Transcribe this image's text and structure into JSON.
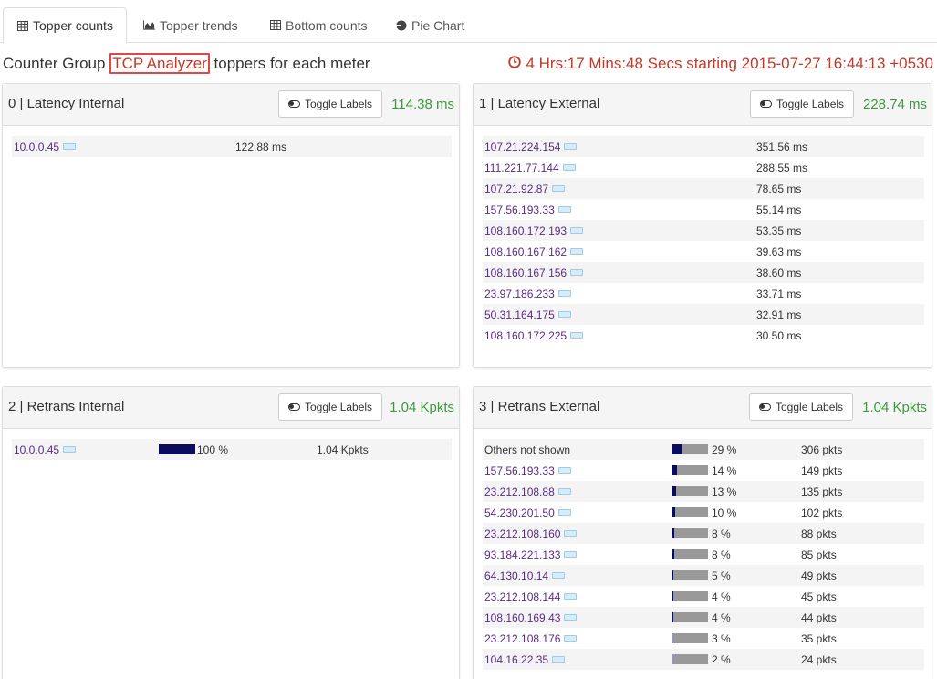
{
  "tabs": [
    {
      "label": "Topper counts",
      "icon": "table-icon",
      "active": true
    },
    {
      "label": "Topper trends",
      "icon": "area-chart-icon",
      "active": false
    },
    {
      "label": "Bottom counts",
      "icon": "table-icon",
      "active": false
    },
    {
      "label": "Pie Chart",
      "icon": "pie-chart-icon",
      "active": false
    }
  ],
  "heading": {
    "prefix": "Counter Group ",
    "group": "TCP Analyzer",
    "suffix": " toppers for each meter"
  },
  "timeinfo": "4 Hrs:17 Mins:48 Secs starting 2015-07-27 16:44:13 +0530",
  "toggle_label": "Toggle Labels",
  "colors": {
    "accent_red": "#c0392b",
    "total_green": "#3c9a3c",
    "link_purple": "#5b2a86",
    "bar_fill": "#0c0c5c",
    "bar_bg": "#999999"
  },
  "panels": [
    {
      "title": "0 | Latency Internal",
      "total": "114.38 ms",
      "rows": [
        {
          "key": "10.0.0.45",
          "link": true,
          "value": "122.88 ms"
        }
      ]
    },
    {
      "title": "1 | Latency External",
      "total": "228.74 ms",
      "rows": [
        {
          "key": "107.21.224.154",
          "link": true,
          "value": "351.56 ms"
        },
        {
          "key": "111.221.77.144",
          "link": true,
          "value": "288.55 ms"
        },
        {
          "key": "107.21.92.87",
          "link": true,
          "value": "78.65 ms"
        },
        {
          "key": "157.56.193.33",
          "link": true,
          "value": "55.14 ms"
        },
        {
          "key": "108.160.172.193",
          "link": true,
          "value": "53.35 ms"
        },
        {
          "key": "108.160.167.162",
          "link": true,
          "value": "39.63 ms"
        },
        {
          "key": "108.160.167.156",
          "link": true,
          "value": "38.60 ms"
        },
        {
          "key": "23.97.186.233",
          "link": true,
          "value": "33.71 ms"
        },
        {
          "key": "50.31.164.175",
          "link": true,
          "value": "32.91 ms"
        },
        {
          "key": "108.160.172.225",
          "link": true,
          "value": "30.50 ms"
        }
      ]
    },
    {
      "title": "2 | Retrans Internal",
      "total": "1.04 Kpkts",
      "rows": [
        {
          "key": "10.0.0.45",
          "link": true,
          "share": 1.0,
          "pct": "100 %",
          "value": "1.04 Kpkts"
        }
      ]
    },
    {
      "title": "3 | Retrans External",
      "total": "1.04 Kpkts",
      "rows": [
        {
          "key": "Others not shown",
          "link": false,
          "share": 0.29,
          "pct": "29 %",
          "value": "306 pkts"
        },
        {
          "key": "157.56.193.33",
          "link": true,
          "share": 0.14,
          "pct": "14 %",
          "value": "149 pkts"
        },
        {
          "key": "23.212.108.88",
          "link": true,
          "share": 0.13,
          "pct": "13 %",
          "value": "135 pkts"
        },
        {
          "key": "54.230.201.50",
          "link": true,
          "share": 0.1,
          "pct": "10 %",
          "value": "102 pkts"
        },
        {
          "key": "23.212.108.160",
          "link": true,
          "share": 0.08,
          "pct": "8 %",
          "value": "88 pkts"
        },
        {
          "key": "93.184.221.133",
          "link": true,
          "share": 0.08,
          "pct": "8 %",
          "value": "85 pkts"
        },
        {
          "key": "64.130.10.14",
          "link": true,
          "share": 0.05,
          "pct": "5 %",
          "value": "49 pkts"
        },
        {
          "key": "23.212.108.144",
          "link": true,
          "share": 0.04,
          "pct": "4 %",
          "value": "45 pkts"
        },
        {
          "key": "108.160.169.43",
          "link": true,
          "share": 0.04,
          "pct": "4 %",
          "value": "44 pkts"
        },
        {
          "key": "23.212.108.176",
          "link": true,
          "share": 0.03,
          "pct": "3 %",
          "value": "35 pkts"
        },
        {
          "key": "104.16.22.35",
          "link": true,
          "share": 0.02,
          "pct": "2 %",
          "value": "24 pkts"
        }
      ]
    }
  ]
}
